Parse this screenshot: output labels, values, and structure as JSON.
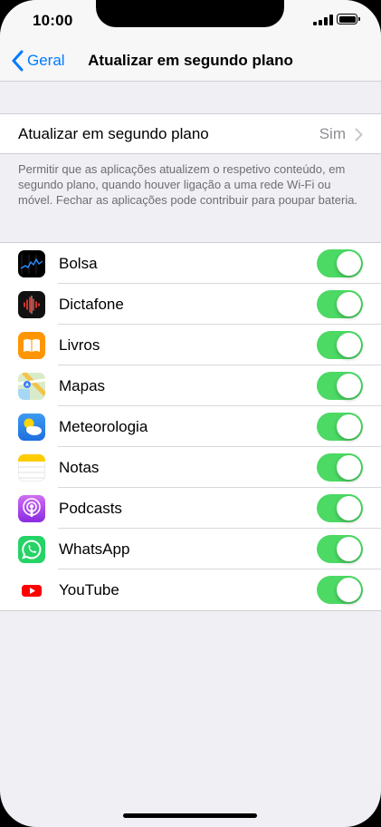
{
  "status_bar": {
    "time": "10:00"
  },
  "nav": {
    "back_label": "Geral",
    "title": "Atualizar em segundo plano"
  },
  "background_refresh": {
    "label": "Atualizar em segundo plano",
    "value": "Sim"
  },
  "note": "Permitir que as aplicações atualizem o respetivo conteúdo, em segundo plano, quando houver ligação a uma rede Wi-Fi ou móvel. Fechar as aplicações pode contribuir para poupar bateria.",
  "apps": [
    {
      "name": "Bolsa",
      "icon": "stocks-icon",
      "enabled": true
    },
    {
      "name": "Dictafone",
      "icon": "voice-memos-icon",
      "enabled": true
    },
    {
      "name": "Livros",
      "icon": "books-icon",
      "enabled": true
    },
    {
      "name": "Mapas",
      "icon": "maps-icon",
      "enabled": true
    },
    {
      "name": "Meteorologia",
      "icon": "weather-icon",
      "enabled": true
    },
    {
      "name": "Notas",
      "icon": "notes-icon",
      "enabled": true
    },
    {
      "name": "Podcasts",
      "icon": "podcasts-icon",
      "enabled": true
    },
    {
      "name": "WhatsApp",
      "icon": "whatsapp-icon",
      "enabled": true
    },
    {
      "name": "YouTube",
      "icon": "youtube-icon",
      "enabled": true
    }
  ],
  "colors": {
    "accent": "#007aff",
    "toggle_on": "#4cd964",
    "background": "#efeff4"
  }
}
